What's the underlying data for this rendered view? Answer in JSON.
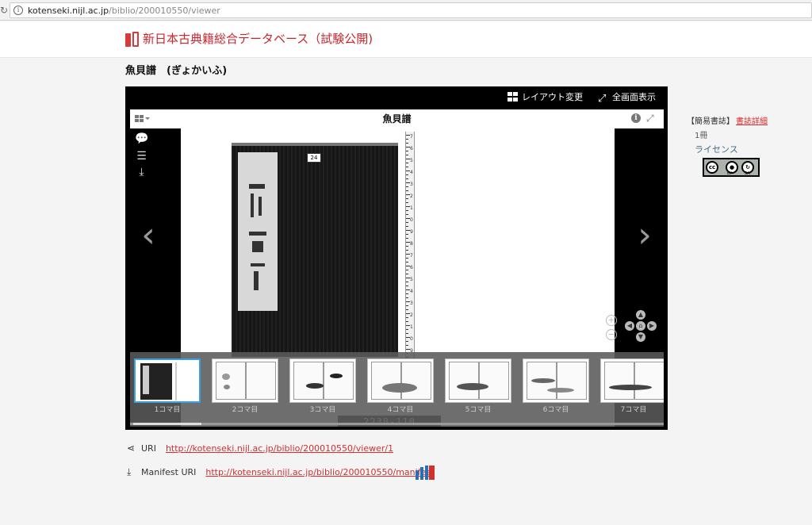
{
  "browser": {
    "url_host": "kotenseki.nijl.ac.jp",
    "url_path": "/biblio/200010550/viewer"
  },
  "site": {
    "title": "新日本古典籍総合データベース（試験公開)"
  },
  "book": {
    "title": "魚貝譜　(ぎょかいふ)"
  },
  "viewer": {
    "layout_label": "レイアウト変更",
    "fullscreen_label": "全画面表示",
    "panel_title": "魚貝譜",
    "tag_text": "24",
    "barcode_text": "2238-110",
    "ruler_numbers": [
      "7",
      "6",
      "5",
      "4",
      "3",
      "2",
      "1",
      "0",
      "9",
      "8",
      "7",
      "6",
      "5",
      "4",
      "3",
      "2",
      "1",
      "0",
      "9"
    ],
    "thumbnails": [
      {
        "label": "1コマ目",
        "active": true
      },
      {
        "label": "2コマ目",
        "active": false
      },
      {
        "label": "3コマ目",
        "active": false
      },
      {
        "label": "4コマ目",
        "active": false
      },
      {
        "label": "5コマ目",
        "active": false
      },
      {
        "label": "6コマ目",
        "active": false
      },
      {
        "label": "7コマ目",
        "active": false
      }
    ]
  },
  "sidebar": {
    "heading": "【簡易書誌】",
    "detail_link": "書誌詳細",
    "volumes": "1冊",
    "license_label": "ライセンス",
    "cc_badge": {
      "cc": "cc",
      "by": "BY",
      "sa": "SA"
    }
  },
  "links": {
    "uri_label": "URI",
    "uri_value": "http://kotenseki.nijl.ac.jp/biblio/200010550/viewer/1",
    "manifest_label": "Manifest URI",
    "manifest_value": "http://kotenseki.nijl.ac.jp/biblio/200010550/manifest"
  },
  "colors": {
    "brand_red": "#c8262e",
    "link_red": "#d32f2f",
    "active_thumb": "#3aa0e0",
    "iiif_blue": "#2a6eb5"
  },
  "icons": [
    "reload-icon",
    "info-icon",
    "logo-icon",
    "grid-icon",
    "expand-icon",
    "comment-icon",
    "sliders-icon",
    "download-icon",
    "chevron-left-icon",
    "chevron-right-icon",
    "zoom-in-icon",
    "zoom-out-icon",
    "pan-home-icon",
    "share-icon",
    "iiif-logo"
  ]
}
